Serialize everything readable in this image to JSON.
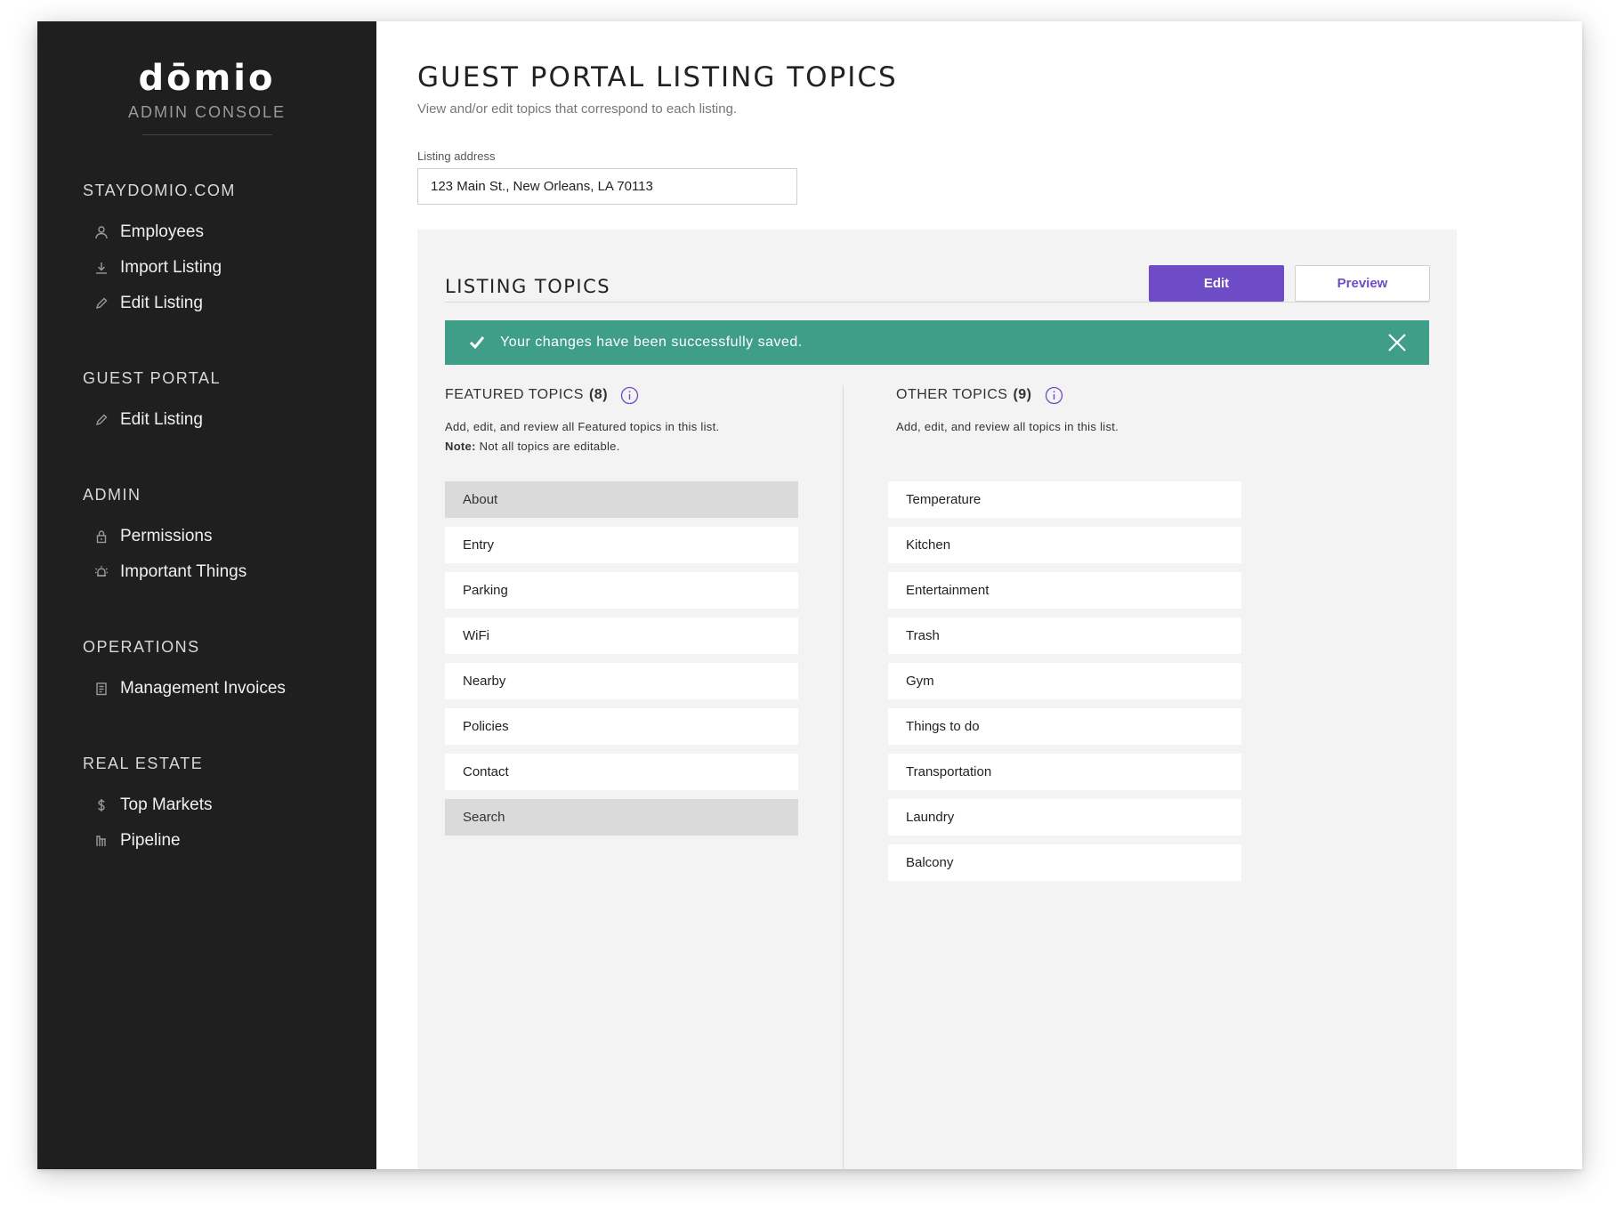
{
  "brand": {
    "logo": "dōmio",
    "subtitle": "ADMIN CONSOLE"
  },
  "sidebar": {
    "sections": [
      {
        "heading": "STAYDOMIO.COM",
        "items": [
          {
            "label": "Employees",
            "icon": "user-icon"
          },
          {
            "label": "Import Listing",
            "icon": "download-icon"
          },
          {
            "label": "Edit Listing",
            "icon": "pencil-icon"
          }
        ]
      },
      {
        "heading": "GUEST PORTAL",
        "items": [
          {
            "label": "Edit Listing",
            "icon": "pencil-icon"
          }
        ]
      },
      {
        "heading": "ADMIN",
        "items": [
          {
            "label": "Permissions",
            "icon": "lock-icon"
          },
          {
            "label": "Important Things",
            "icon": "alarm-icon"
          }
        ]
      },
      {
        "heading": "OPERATIONS",
        "items": [
          {
            "label": "Management Invoices",
            "icon": "invoice-icon"
          }
        ]
      },
      {
        "heading": "REAL ESTATE",
        "items": [
          {
            "label": "Top Markets",
            "icon": "dollar-icon"
          },
          {
            "label": "Pipeline",
            "icon": "pipeline-icon"
          }
        ]
      }
    ]
  },
  "main": {
    "title": "GUEST PORTAL LISTING TOPICS",
    "subtitle": "View and/or edit topics that correspond to each listing.",
    "address_label": "Listing address",
    "address_value": "123 Main St., New Orleans, LA 70113"
  },
  "panel": {
    "title": "LISTING TOPICS",
    "edit_label": "Edit",
    "preview_label": "Preview",
    "alert_text": "Your changes have been successfully saved.",
    "featured": {
      "heading": "FEATURED TOPICS",
      "count": "(8)",
      "desc": "Add, edit, and review all Featured topics in this list.",
      "note_label": "Note:",
      "note_text": " Not all topics are editable.",
      "topics": [
        {
          "label": "About",
          "disabled": true
        },
        {
          "label": "Entry",
          "disabled": false
        },
        {
          "label": "Parking",
          "disabled": false
        },
        {
          "label": "WiFi",
          "disabled": false
        },
        {
          "label": "Nearby",
          "disabled": false
        },
        {
          "label": "Policies",
          "disabled": false
        },
        {
          "label": "Contact",
          "disabled": false
        },
        {
          "label": "Search",
          "disabled": true
        }
      ]
    },
    "other": {
      "heading": "OTHER TOPICS",
      "count": "(9)",
      "desc": "Add, edit, and review all topics in this list.",
      "topics": [
        {
          "label": "Temperature"
        },
        {
          "label": "Kitchen"
        },
        {
          "label": "Entertainment"
        },
        {
          "label": "Trash"
        },
        {
          "label": "Gym"
        },
        {
          "label": "Things to do"
        },
        {
          "label": "Transportation"
        },
        {
          "label": "Laundry"
        },
        {
          "label": "Balcony"
        }
      ]
    }
  },
  "colors": {
    "sidebar_bg": "#1f1f1f",
    "accent": "#6e4bc7",
    "success": "#3e9e87",
    "panel_bg": "#f3f3f3"
  }
}
